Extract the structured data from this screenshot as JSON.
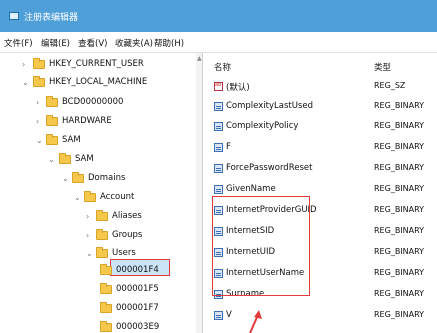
{
  "window": {
    "title": "注册表编辑器",
    "accent": "#4f9fd9"
  },
  "menu": [
    "文件(F)",
    "编辑(E)",
    "查看(V)",
    "收藏夹(A)",
    "帮助(H)"
  ],
  "tree": {
    "nodes": [
      {
        "label": "HKEY_CURRENT_USER",
        "expanded": false
      },
      {
        "label": "HKEY_LOCAL_MACHINE",
        "expanded": true
      },
      {
        "label": "BCD00000000",
        "expanded": false
      },
      {
        "label": "HARDWARE",
        "expanded": false
      },
      {
        "label": "SAM",
        "expanded": true
      },
      {
        "label": "SAM",
        "expanded": true
      },
      {
        "label": "Domains",
        "expanded": true
      },
      {
        "label": "Account",
        "expanded": true
      },
      {
        "label": "Aliases",
        "expanded": false
      },
      {
        "label": "Groups",
        "expanded": false
      },
      {
        "label": "Users",
        "expanded": true
      },
      {
        "label": "000001F4",
        "selected": true
      },
      {
        "label": "000001F5"
      },
      {
        "label": "000001F7"
      },
      {
        "label": "000003E9"
      }
    ]
  },
  "values_list": {
    "headers": {
      "name": "名称",
      "type": "类型"
    },
    "rows": [
      {
        "name": "(默认)",
        "type": "REG_SZ",
        "icon": "string-value-icon"
      },
      {
        "name": "ComplexityLastUsed",
        "type": "REG_BINARY",
        "icon": "binary-value-icon"
      },
      {
        "name": "ComplexityPolicy",
        "type": "REG_BINARY",
        "icon": "binary-value-icon"
      },
      {
        "name": "F",
        "type": "REG_BINARY",
        "icon": "binary-value-icon"
      },
      {
        "name": "ForcePasswordReset",
        "type": "REG_BINARY",
        "icon": "binary-value-icon"
      },
      {
        "name": "GivenName",
        "type": "REG_BINARY",
        "icon": "binary-value-icon"
      },
      {
        "name": "InternetProviderGUID",
        "type": "REG_BINARY",
        "icon": "binary-value-icon"
      },
      {
        "name": "InternetSID",
        "type": "REG_BINARY",
        "icon": "binary-value-icon"
      },
      {
        "name": "InternetUID",
        "type": "REG_BINARY",
        "icon": "binary-value-icon"
      },
      {
        "name": "InternetUserName",
        "type": "REG_BINARY",
        "icon": "binary-value-icon"
      },
      {
        "name": "Surname",
        "type": "REG_BINARY",
        "icon": "binary-value-icon"
      },
      {
        "name": "V",
        "type": "REG_BINARY",
        "icon": "binary-value-icon"
      }
    ]
  },
  "annotation_color": "#e23b3b"
}
